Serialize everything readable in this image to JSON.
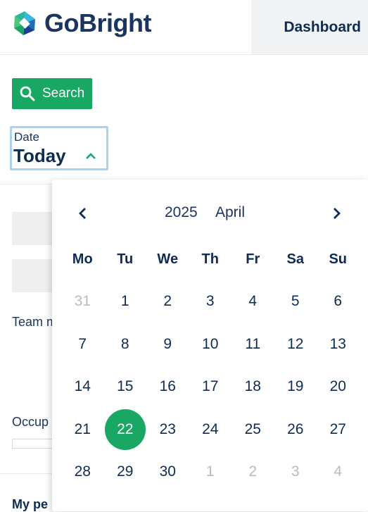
{
  "header": {
    "brand": "GoBright",
    "nav_tab": "Dashboard"
  },
  "toolbar": {
    "search_label": "Search"
  },
  "date_picker": {
    "label": "Date",
    "value": "Today"
  },
  "background": {
    "team_text": "Team m",
    "occupancy_text": "Occup",
    "my_text": "My pe"
  },
  "calendar": {
    "year": "2025",
    "month": "April",
    "weekdays": [
      "Mo",
      "Tu",
      "We",
      "Th",
      "Fr",
      "Sa",
      "Su"
    ],
    "days": [
      {
        "label": "31",
        "muted": true
      },
      {
        "label": "1"
      },
      {
        "label": "2"
      },
      {
        "label": "3"
      },
      {
        "label": "4"
      },
      {
        "label": "5"
      },
      {
        "label": "6"
      },
      {
        "label": "7"
      },
      {
        "label": "8"
      },
      {
        "label": "9"
      },
      {
        "label": "10"
      },
      {
        "label": "11"
      },
      {
        "label": "12"
      },
      {
        "label": "13"
      },
      {
        "label": "14"
      },
      {
        "label": "15"
      },
      {
        "label": "16"
      },
      {
        "label": "17"
      },
      {
        "label": "18"
      },
      {
        "label": "19"
      },
      {
        "label": "20"
      },
      {
        "label": "21"
      },
      {
        "label": "22",
        "selected": true
      },
      {
        "label": "23"
      },
      {
        "label": "24"
      },
      {
        "label": "25"
      },
      {
        "label": "26"
      },
      {
        "label": "27"
      },
      {
        "label": "28"
      },
      {
        "label": "29"
      },
      {
        "label": "30"
      },
      {
        "label": "1",
        "muted": true
      },
      {
        "label": "2",
        "muted": true
      },
      {
        "label": "3",
        "muted": true
      },
      {
        "label": "4",
        "muted": true
      }
    ]
  },
  "colors": {
    "brand_green": "#19a864",
    "navy": "#0e2c52",
    "focus_blue": "#a9d3f5",
    "muted_day": "#b8bcc2"
  },
  "icons": {
    "logo": "gobright-logo-icon",
    "search": "search-icon",
    "chevron_up": "chevron-up-icon",
    "prev": "chevron-left-icon",
    "next": "chevron-right-icon"
  }
}
